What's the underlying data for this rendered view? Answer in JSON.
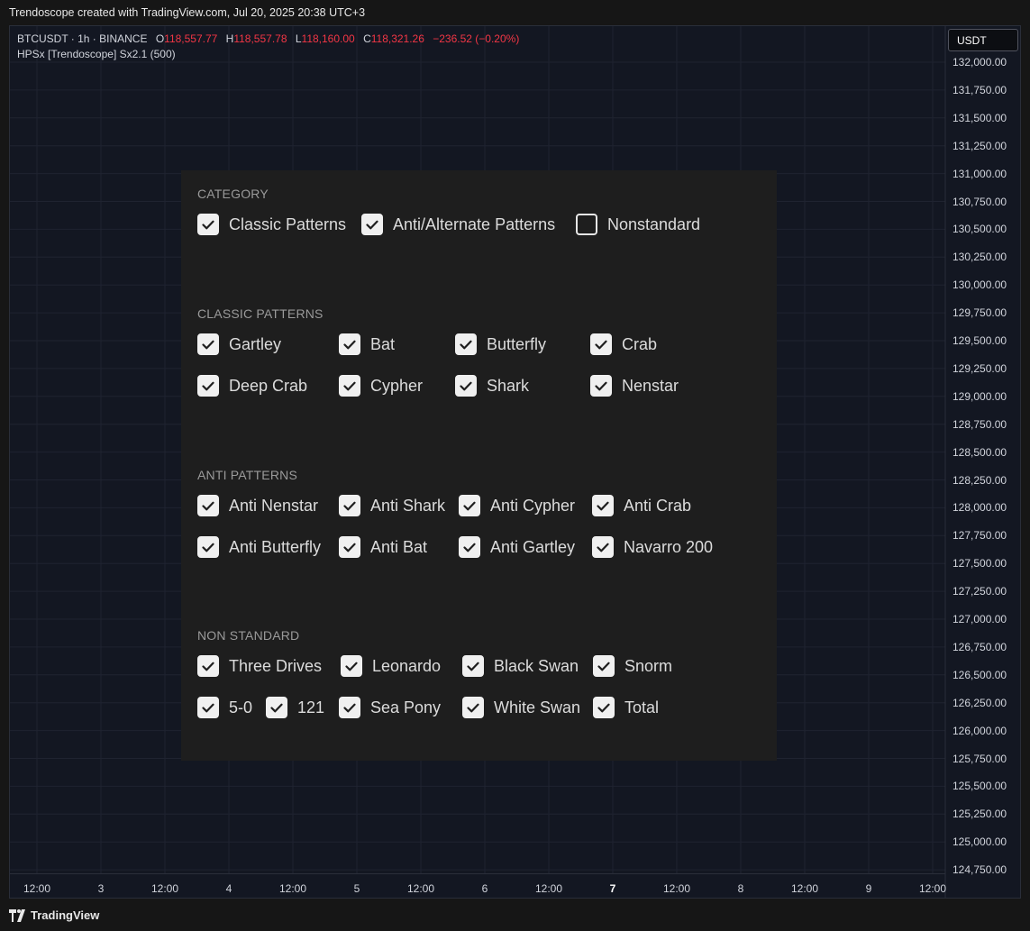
{
  "banner": "Trendoscope created with TradingView.com, Jul 20, 2025 20:38 UTC+3",
  "legend": {
    "symbol": "BTCUSDT · 1h · BINANCE",
    "o_label": "O",
    "o_val": "118,557.77",
    "h_label": "H",
    "h_val": "118,557.78",
    "l_label": "L",
    "l_val": "118,160.00",
    "c_label": "C",
    "c_val": "118,321.26",
    "change": "−236.52 (−0.20%)",
    "indicator": "HPSx [Trendoscope] Sx2.1 (500)"
  },
  "currency": "USDT",
  "price_axis": [
    "132,000.00",
    "131,750.00",
    "131,500.00",
    "131,250.00",
    "131,000.00",
    "130,750.00",
    "130,500.00",
    "130,250.00",
    "130,000.00",
    "129,750.00",
    "129,500.00",
    "129,250.00",
    "129,000.00",
    "128,750.00",
    "128,500.00",
    "128,250.00",
    "128,000.00",
    "127,750.00",
    "127,500.00",
    "127,250.00",
    "127,000.00",
    "126,750.00",
    "126,500.00",
    "126,250.00",
    "126,000.00",
    "125,750.00",
    "125,500.00",
    "125,250.00",
    "125,000.00",
    "124,750.00"
  ],
  "time_axis": [
    "12:00",
    "3",
    "12:00",
    "4",
    "12:00",
    "5",
    "12:00",
    "6",
    "12:00",
    "7",
    "12:00",
    "8",
    "12:00",
    "9",
    "12:00"
  ],
  "time_axis_bold": "7",
  "panel": {
    "sections": [
      {
        "title": "CATEGORY",
        "rows": [
          [
            {
              "label": "Classic Patterns",
              "checked": true
            },
            {
              "label": "Anti/Alternate Patterns",
              "checked": true
            },
            {
              "label": "Nonstandard",
              "checked": false
            }
          ]
        ]
      },
      {
        "title": "CLASSIC PATTERNS",
        "rows": [
          [
            {
              "label": "Gartley",
              "checked": true
            },
            {
              "label": "Bat",
              "checked": true
            },
            {
              "label": "Butterfly",
              "checked": true
            },
            {
              "label": "Crab",
              "checked": true
            }
          ],
          [
            {
              "label": "Deep Crab",
              "checked": true
            },
            {
              "label": "Cypher",
              "checked": true
            },
            {
              "label": "Shark",
              "checked": true
            },
            {
              "label": "Nenstar",
              "checked": true
            }
          ]
        ]
      },
      {
        "title": "ANTI PATTERNS",
        "rows": [
          [
            {
              "label": "Anti Nenstar",
              "checked": true
            },
            {
              "label": "Anti Shark",
              "checked": true
            },
            {
              "label": "Anti Cypher",
              "checked": true
            },
            {
              "label": "Anti Crab",
              "checked": true
            }
          ],
          [
            {
              "label": "Anti Butterfly",
              "checked": true
            },
            {
              "label": "Anti Bat",
              "checked": true
            },
            {
              "label": "Anti Gartley",
              "checked": true
            },
            {
              "label": "Navarro 200",
              "checked": true
            }
          ]
        ]
      },
      {
        "title": "NON STANDARD",
        "rows": [
          [
            {
              "label": "Three Drives",
              "checked": true
            },
            {
              "label": "Leonardo",
              "checked": true
            },
            {
              "label": "Black Swan",
              "checked": true
            },
            {
              "label": "Snorm",
              "checked": true
            }
          ],
          [
            {
              "label": "5-0",
              "checked": true
            },
            {
              "label": "121",
              "checked": true
            },
            {
              "label": "Sea Pony",
              "checked": true
            },
            {
              "label": "White Swan",
              "checked": true
            },
            {
              "label": "Total",
              "checked": true
            }
          ]
        ]
      }
    ]
  },
  "footer": "TradingView",
  "colors": {
    "background": "#131722",
    "panel": "#1e1e1e",
    "down": "#f23645",
    "grid": "#1f2330"
  }
}
